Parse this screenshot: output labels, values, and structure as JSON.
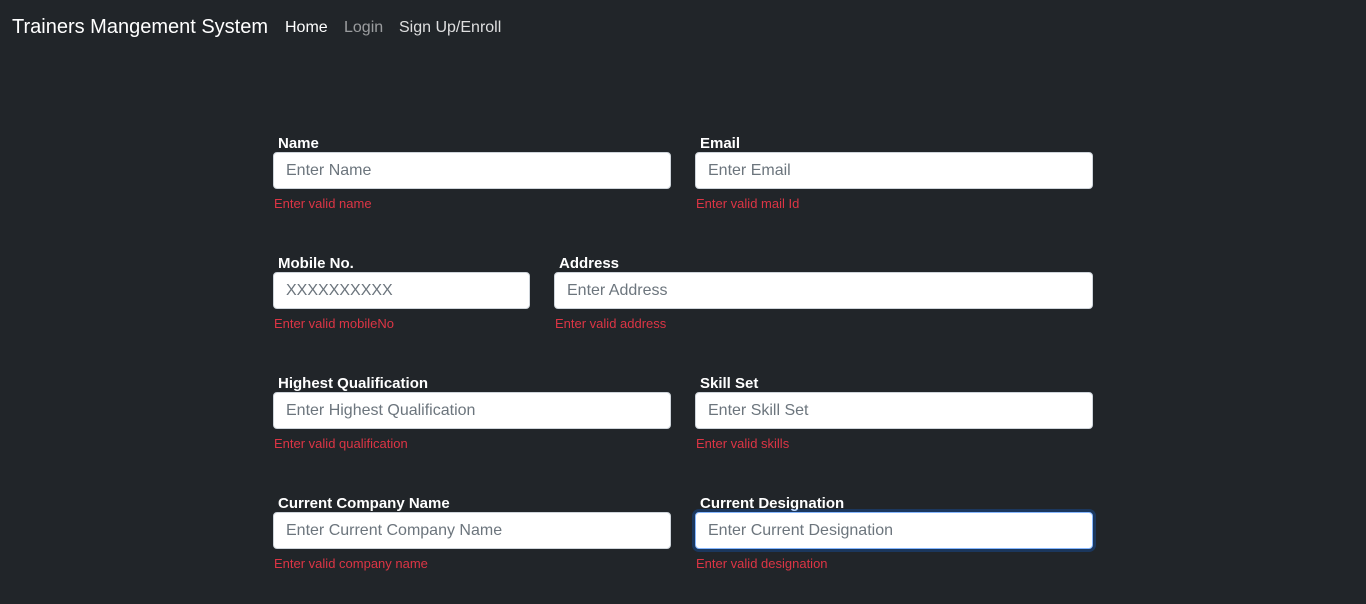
{
  "navbar": {
    "brand": "Trainers Mangement System",
    "links": [
      {
        "label": "Home"
      },
      {
        "label": "Login"
      },
      {
        "label": "Sign Up/Enroll"
      }
    ]
  },
  "form": {
    "name": {
      "label": "Name",
      "placeholder": "Enter Name",
      "value": "",
      "error": "Enter valid name"
    },
    "email": {
      "label": "Email",
      "placeholder": "Enter Email",
      "value": "",
      "error": "Enter valid mail Id"
    },
    "mobile": {
      "label": "Mobile No.",
      "placeholder": "XXXXXXXXXX",
      "value": "",
      "error": "Enter valid mobileNo"
    },
    "address": {
      "label": "Address",
      "placeholder": "Enter Address",
      "value": "",
      "error": "Enter valid address"
    },
    "qualification": {
      "label": "Highest Qualification",
      "placeholder": "Enter Highest Qualification",
      "value": "",
      "error": "Enter valid qualification"
    },
    "skills": {
      "label": "Skill Set",
      "placeholder": "Enter Skill Set",
      "value": "",
      "error": "Enter valid skills"
    },
    "company": {
      "label": "Current Company Name",
      "placeholder": "Enter Current Company Name",
      "value": "",
      "error": "Enter valid company name"
    },
    "designation": {
      "label": "Current Designation",
      "placeholder": "Enter Current Designation",
      "value": "",
      "error": "Enter valid designation"
    }
  },
  "colors": {
    "background": "#212529",
    "error": "#dc3545",
    "focus_ring": "#86b7fe"
  }
}
